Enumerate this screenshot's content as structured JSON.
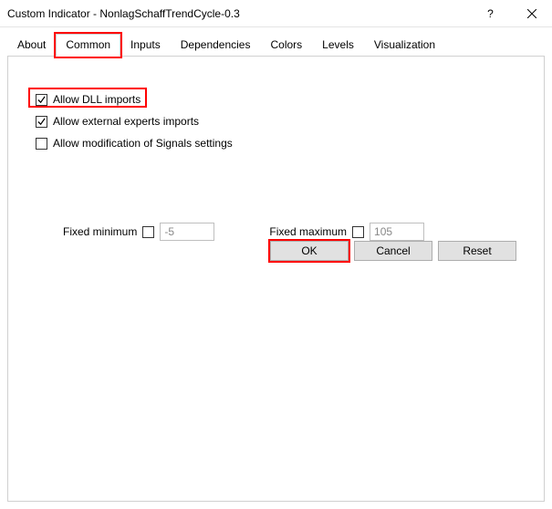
{
  "window": {
    "title": "Custom Indicator - NonlagSchaffTrendCycle-0.3"
  },
  "tabs": {
    "about": "About",
    "common": "Common",
    "inputs": "Inputs",
    "dependencies": "Dependencies",
    "colors": "Colors",
    "levels": "Levels",
    "visualization": "Visualization"
  },
  "common": {
    "allow_dll": "Allow DLL imports",
    "allow_experts": "Allow external experts imports",
    "allow_signals": "Allow modification of Signals settings",
    "fixed_min_label": "Fixed minimum",
    "fixed_min_value": "-5",
    "fixed_max_label": "Fixed maximum",
    "fixed_max_value": "105"
  },
  "buttons": {
    "ok": "OK",
    "cancel": "Cancel",
    "reset": "Reset"
  }
}
